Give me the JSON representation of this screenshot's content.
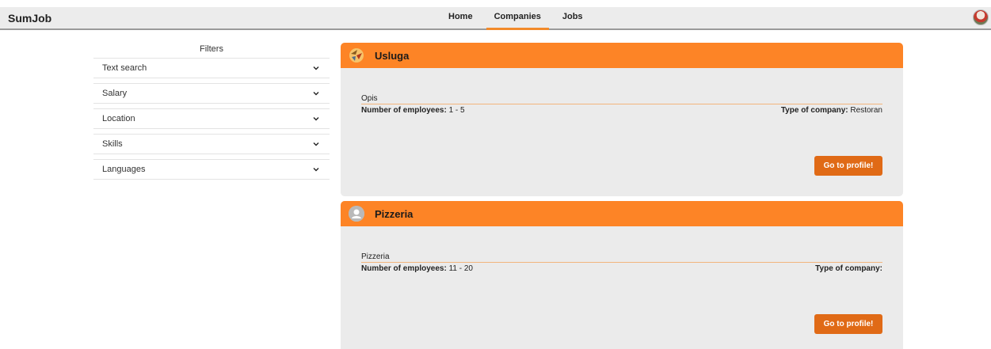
{
  "nav": {
    "brand": "SumJob",
    "links": [
      {
        "label": "Home",
        "active": false
      },
      {
        "label": "Companies",
        "active": true
      },
      {
        "label": "Jobs",
        "active": false
      }
    ],
    "avatar_icon": "user-avatar"
  },
  "filters": {
    "title": "Filters",
    "items": [
      {
        "label": "Text search",
        "icon": "chevron-down-icon"
      },
      {
        "label": "Salary",
        "icon": "chevron-down-icon"
      },
      {
        "label": "Location",
        "icon": "chevron-down-icon"
      },
      {
        "label": "Skills",
        "icon": "chevron-down-icon"
      },
      {
        "label": "Languages",
        "icon": "chevron-down-icon"
      }
    ]
  },
  "companies": [
    {
      "name": "Usluga",
      "logo_icon": "company-logo-icon",
      "description": "Opis",
      "employees_label": "Number of employees:",
      "employees_value": "1 - 5",
      "type_label": "Type of company:",
      "type_value": "Restoran",
      "button_label": "Go to profile!"
    },
    {
      "name": "Pizzeria",
      "logo_icon": "default-user-icon",
      "description": "Pizzeria",
      "employees_label": "Number of employees:",
      "employees_value": "11 - 20",
      "type_label": "Type of company:",
      "type_value": "",
      "button_label": "Go to profile!"
    }
  ],
  "colors": {
    "accent": "#fd8426",
    "button": "#e06a16",
    "card_bg": "#ebebeb"
  }
}
